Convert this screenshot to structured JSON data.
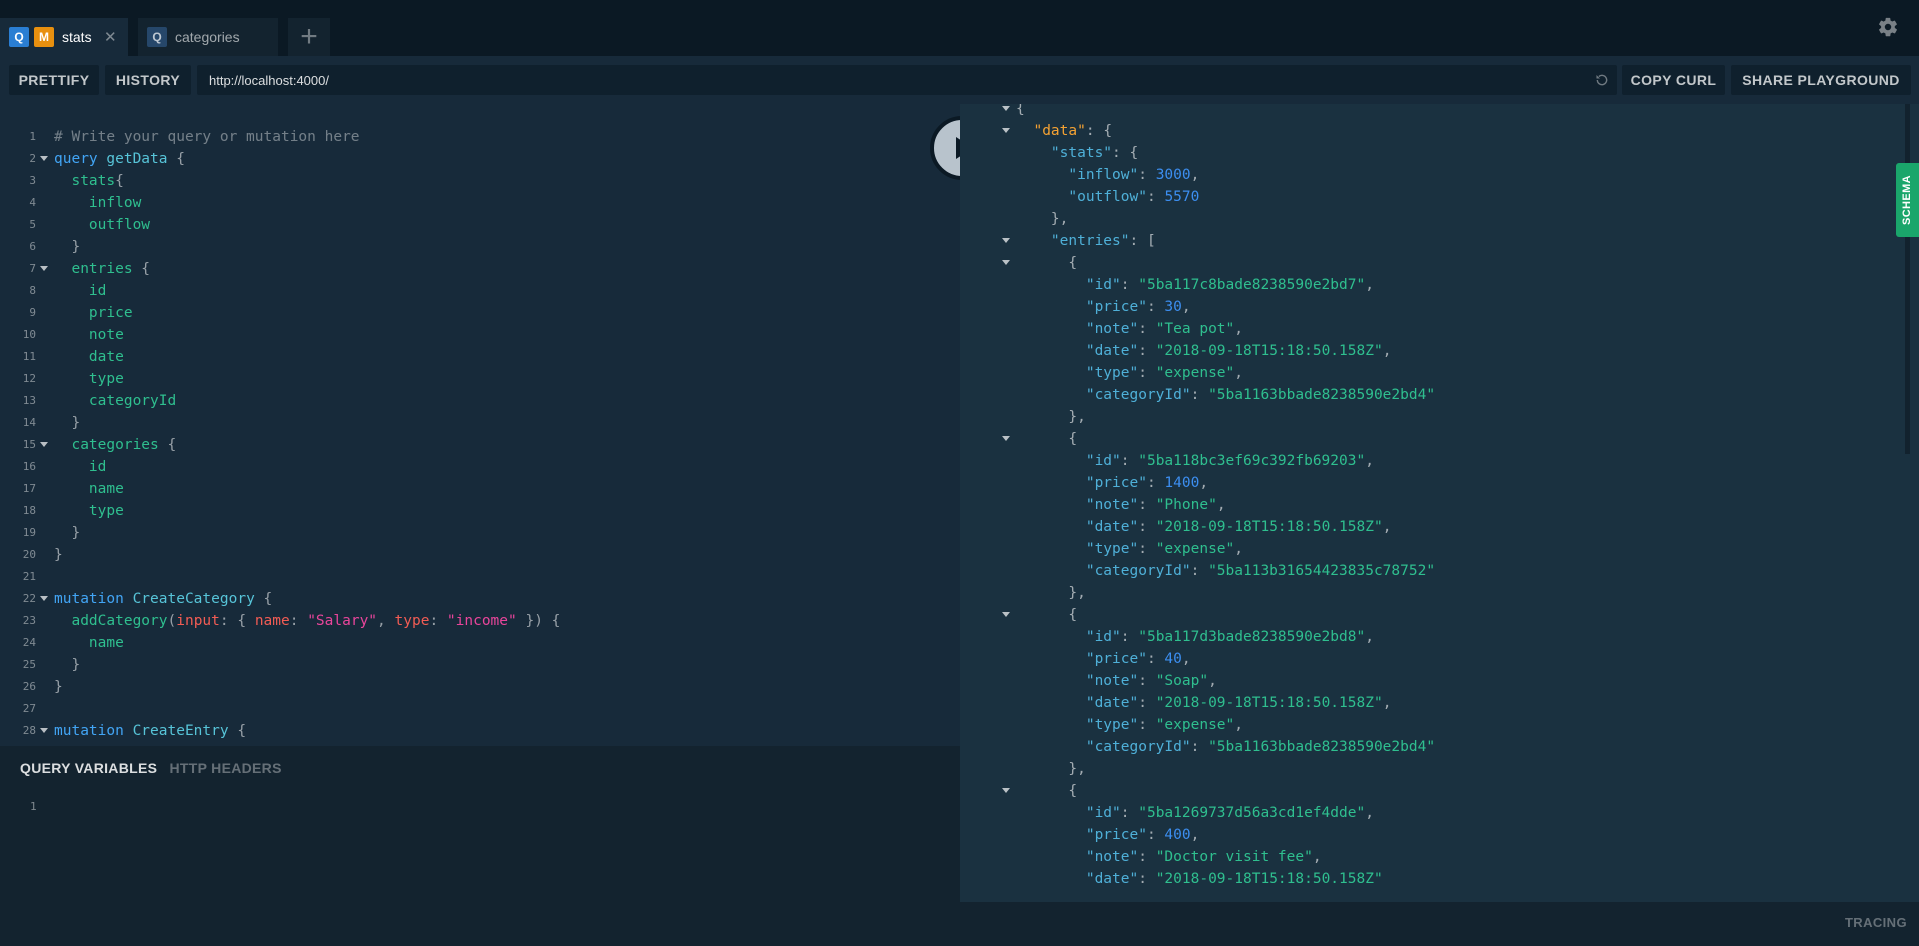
{
  "tabs": [
    {
      "badges": [
        "Q",
        "M"
      ],
      "title": "stats",
      "close": "✕"
    },
    {
      "badges": [
        "Q"
      ],
      "title": "categories"
    }
  ],
  "add_tab_label": "+",
  "toolbar": {
    "prettify": "PRETTIFY",
    "history": "HISTORY",
    "url": "http://localhost:4000/",
    "copy_curl": "COPY CURL",
    "share": "SHARE PLAYGROUND"
  },
  "editor_lines": [
    {
      "n": "1",
      "fold": false,
      "tokens": [
        [
          "c-comment",
          "# Write your query or mutation here"
        ]
      ]
    },
    {
      "n": "2",
      "fold": true,
      "tokens": [
        [
          "c-kw",
          "query "
        ],
        [
          "c-def",
          "getData"
        ],
        [
          "c-punc",
          " {"
        ]
      ]
    },
    {
      "n": "3",
      "fold": false,
      "tokens": [
        [
          "c-field",
          "  stats"
        ],
        [
          "c-punc",
          "{"
        ]
      ]
    },
    {
      "n": "4",
      "fold": false,
      "tokens": [
        [
          "c-field",
          "    inflow"
        ]
      ]
    },
    {
      "n": "5",
      "fold": false,
      "tokens": [
        [
          "c-field",
          "    outflow"
        ]
      ]
    },
    {
      "n": "6",
      "fold": false,
      "tokens": [
        [
          "c-punc",
          "  }"
        ]
      ]
    },
    {
      "n": "7",
      "fold": true,
      "tokens": [
        [
          "c-field",
          "  entries"
        ],
        [
          "c-punc",
          " {"
        ]
      ]
    },
    {
      "n": "8",
      "fold": false,
      "tokens": [
        [
          "c-field",
          "    id"
        ]
      ]
    },
    {
      "n": "9",
      "fold": false,
      "tokens": [
        [
          "c-field",
          "    price"
        ]
      ]
    },
    {
      "n": "10",
      "fold": false,
      "tokens": [
        [
          "c-field",
          "    note"
        ]
      ]
    },
    {
      "n": "11",
      "fold": false,
      "tokens": [
        [
          "c-field",
          "    date"
        ]
      ]
    },
    {
      "n": "12",
      "fold": false,
      "tokens": [
        [
          "c-field",
          "    type"
        ]
      ]
    },
    {
      "n": "13",
      "fold": false,
      "tokens": [
        [
          "c-field",
          "    categoryId"
        ]
      ]
    },
    {
      "n": "14",
      "fold": false,
      "tokens": [
        [
          "c-punc",
          "  }"
        ]
      ]
    },
    {
      "n": "15",
      "fold": true,
      "tokens": [
        [
          "c-field",
          "  categories"
        ],
        [
          "c-punc",
          " {"
        ]
      ]
    },
    {
      "n": "16",
      "fold": false,
      "tokens": [
        [
          "c-field",
          "    id"
        ]
      ]
    },
    {
      "n": "17",
      "fold": false,
      "tokens": [
        [
          "c-field",
          "    name"
        ]
      ]
    },
    {
      "n": "18",
      "fold": false,
      "tokens": [
        [
          "c-field",
          "    type"
        ]
      ]
    },
    {
      "n": "19",
      "fold": false,
      "tokens": [
        [
          "c-punc",
          "  }"
        ]
      ]
    },
    {
      "n": "20",
      "fold": false,
      "tokens": [
        [
          "c-punc",
          "}"
        ]
      ]
    },
    {
      "n": "21",
      "fold": false,
      "tokens": []
    },
    {
      "n": "22",
      "fold": true,
      "tokens": [
        [
          "c-kw",
          "mutation "
        ],
        [
          "c-def",
          "CreateCategory"
        ],
        [
          "c-punc",
          " {"
        ]
      ]
    },
    {
      "n": "23",
      "fold": false,
      "tokens": [
        [
          "c-field",
          "  addCategory"
        ],
        [
          "c-punc",
          "("
        ],
        [
          "c-arg",
          "input"
        ],
        [
          "c-punc",
          ": { "
        ],
        [
          "c-arg",
          "name"
        ],
        [
          "c-punc",
          ": "
        ],
        [
          "c-str",
          "\"Salary\""
        ],
        [
          "c-punc",
          ", "
        ],
        [
          "c-arg",
          "type"
        ],
        [
          "c-punc",
          ": "
        ],
        [
          "c-str",
          "\"income\""
        ],
        [
          "c-punc",
          " }) {"
        ]
      ]
    },
    {
      "n": "24",
      "fold": false,
      "tokens": [
        [
          "c-field",
          "    name"
        ]
      ]
    },
    {
      "n": "25",
      "fold": false,
      "tokens": [
        [
          "c-punc",
          "  }"
        ]
      ]
    },
    {
      "n": "26",
      "fold": false,
      "tokens": [
        [
          "c-punc",
          "}"
        ]
      ]
    },
    {
      "n": "27",
      "fold": false,
      "tokens": []
    },
    {
      "n": "28",
      "fold": true,
      "tokens": [
        [
          "c-kw",
          "mutation "
        ],
        [
          "c-def",
          "CreateEntry"
        ],
        [
          "c-punc",
          " {"
        ]
      ]
    }
  ],
  "vars_panel": {
    "query_variables": "QUERY VARIABLES",
    "http_headers": "HTTP HEADERS",
    "line_number": "1"
  },
  "result_lines": [
    {
      "fold": true,
      "tokens": [
        [
          "r-punc",
          "{"
        ]
      ]
    },
    {
      "fold": true,
      "tokens": [
        [
          "r-punc",
          "  "
        ],
        [
          "r-key-data",
          "\"data\""
        ],
        [
          "r-punc",
          ": {"
        ]
      ]
    },
    {
      "fold": false,
      "tokens": [
        [
          "r-punc",
          "    "
        ],
        [
          "r-key",
          "\"stats\""
        ],
        [
          "r-punc",
          ": {"
        ]
      ]
    },
    {
      "fold": false,
      "tokens": [
        [
          "r-punc",
          "      "
        ],
        [
          "r-key",
          "\"inflow\""
        ],
        [
          "r-punc",
          ": "
        ],
        [
          "r-num",
          "3000"
        ],
        [
          "r-punc",
          ","
        ]
      ]
    },
    {
      "fold": false,
      "tokens": [
        [
          "r-punc",
          "      "
        ],
        [
          "r-key",
          "\"outflow\""
        ],
        [
          "r-punc",
          ": "
        ],
        [
          "r-num",
          "5570"
        ]
      ]
    },
    {
      "fold": false,
      "tokens": [
        [
          "r-punc",
          "    },"
        ]
      ]
    },
    {
      "fold": true,
      "tokens": [
        [
          "r-punc",
          "    "
        ],
        [
          "r-key",
          "\"entries\""
        ],
        [
          "r-punc",
          ": ["
        ]
      ]
    },
    {
      "fold": true,
      "tokens": [
        [
          "r-punc",
          "      {"
        ]
      ]
    },
    {
      "fold": false,
      "tokens": [
        [
          "r-punc",
          "        "
        ],
        [
          "r-key",
          "\"id\""
        ],
        [
          "r-punc",
          ": "
        ],
        [
          "r-str",
          "\"5ba117c8bade8238590e2bd7\""
        ],
        [
          "r-punc",
          ","
        ]
      ]
    },
    {
      "fold": false,
      "tokens": [
        [
          "r-punc",
          "        "
        ],
        [
          "r-key",
          "\"price\""
        ],
        [
          "r-punc",
          ": "
        ],
        [
          "r-num",
          "30"
        ],
        [
          "r-punc",
          ","
        ]
      ]
    },
    {
      "fold": false,
      "tokens": [
        [
          "r-punc",
          "        "
        ],
        [
          "r-key",
          "\"note\""
        ],
        [
          "r-punc",
          ": "
        ],
        [
          "r-str",
          "\"Tea pot\""
        ],
        [
          "r-punc",
          ","
        ]
      ]
    },
    {
      "fold": false,
      "tokens": [
        [
          "r-punc",
          "        "
        ],
        [
          "r-key",
          "\"date\""
        ],
        [
          "r-punc",
          ": "
        ],
        [
          "r-str",
          "\"2018-09-18T15:18:50.158Z\""
        ],
        [
          "r-punc",
          ","
        ]
      ]
    },
    {
      "fold": false,
      "tokens": [
        [
          "r-punc",
          "        "
        ],
        [
          "r-key",
          "\"type\""
        ],
        [
          "r-punc",
          ": "
        ],
        [
          "r-str",
          "\"expense\""
        ],
        [
          "r-punc",
          ","
        ]
      ]
    },
    {
      "fold": false,
      "tokens": [
        [
          "r-punc",
          "        "
        ],
        [
          "r-key",
          "\"categoryId\""
        ],
        [
          "r-punc",
          ": "
        ],
        [
          "r-str",
          "\"5ba1163bbade8238590e2bd4\""
        ]
      ]
    },
    {
      "fold": false,
      "tokens": [
        [
          "r-punc",
          "      },"
        ]
      ]
    },
    {
      "fold": true,
      "tokens": [
        [
          "r-punc",
          "      {"
        ]
      ]
    },
    {
      "fold": false,
      "tokens": [
        [
          "r-punc",
          "        "
        ],
        [
          "r-key",
          "\"id\""
        ],
        [
          "r-punc",
          ": "
        ],
        [
          "r-str",
          "\"5ba118bc3ef69c392fb69203\""
        ],
        [
          "r-punc",
          ","
        ]
      ]
    },
    {
      "fold": false,
      "tokens": [
        [
          "r-punc",
          "        "
        ],
        [
          "r-key",
          "\"price\""
        ],
        [
          "r-punc",
          ": "
        ],
        [
          "r-num",
          "1400"
        ],
        [
          "r-punc",
          ","
        ]
      ]
    },
    {
      "fold": false,
      "tokens": [
        [
          "r-punc",
          "        "
        ],
        [
          "r-key",
          "\"note\""
        ],
        [
          "r-punc",
          ": "
        ],
        [
          "r-str",
          "\"Phone\""
        ],
        [
          "r-punc",
          ","
        ]
      ]
    },
    {
      "fold": false,
      "tokens": [
        [
          "r-punc",
          "        "
        ],
        [
          "r-key",
          "\"date\""
        ],
        [
          "r-punc",
          ": "
        ],
        [
          "r-str",
          "\"2018-09-18T15:18:50.158Z\""
        ],
        [
          "r-punc",
          ","
        ]
      ]
    },
    {
      "fold": false,
      "tokens": [
        [
          "r-punc",
          "        "
        ],
        [
          "r-key",
          "\"type\""
        ],
        [
          "r-punc",
          ": "
        ],
        [
          "r-str",
          "\"expense\""
        ],
        [
          "r-punc",
          ","
        ]
      ]
    },
    {
      "fold": false,
      "tokens": [
        [
          "r-punc",
          "        "
        ],
        [
          "r-key",
          "\"categoryId\""
        ],
        [
          "r-punc",
          ": "
        ],
        [
          "r-str",
          "\"5ba113b31654423835c78752\""
        ]
      ]
    },
    {
      "fold": false,
      "tokens": [
        [
          "r-punc",
          "      },"
        ]
      ]
    },
    {
      "fold": true,
      "tokens": [
        [
          "r-punc",
          "      {"
        ]
      ]
    },
    {
      "fold": false,
      "tokens": [
        [
          "r-punc",
          "        "
        ],
        [
          "r-key",
          "\"id\""
        ],
        [
          "r-punc",
          ": "
        ],
        [
          "r-str",
          "\"5ba117d3bade8238590e2bd8\""
        ],
        [
          "r-punc",
          ","
        ]
      ]
    },
    {
      "fold": false,
      "tokens": [
        [
          "r-punc",
          "        "
        ],
        [
          "r-key",
          "\"price\""
        ],
        [
          "r-punc",
          ": "
        ],
        [
          "r-num",
          "40"
        ],
        [
          "r-punc",
          ","
        ]
      ]
    },
    {
      "fold": false,
      "tokens": [
        [
          "r-punc",
          "        "
        ],
        [
          "r-key",
          "\"note\""
        ],
        [
          "r-punc",
          ": "
        ],
        [
          "r-str",
          "\"Soap\""
        ],
        [
          "r-punc",
          ","
        ]
      ]
    },
    {
      "fold": false,
      "tokens": [
        [
          "r-punc",
          "        "
        ],
        [
          "r-key",
          "\"date\""
        ],
        [
          "r-punc",
          ": "
        ],
        [
          "r-str",
          "\"2018-09-18T15:18:50.158Z\""
        ],
        [
          "r-punc",
          ","
        ]
      ]
    },
    {
      "fold": false,
      "tokens": [
        [
          "r-punc",
          "        "
        ],
        [
          "r-key",
          "\"type\""
        ],
        [
          "r-punc",
          ": "
        ],
        [
          "r-str",
          "\"expense\""
        ],
        [
          "r-punc",
          ","
        ]
      ]
    },
    {
      "fold": false,
      "tokens": [
        [
          "r-punc",
          "        "
        ],
        [
          "r-key",
          "\"categoryId\""
        ],
        [
          "r-punc",
          ": "
        ],
        [
          "r-str",
          "\"5ba1163bbade8238590e2bd4\""
        ]
      ]
    },
    {
      "fold": false,
      "tokens": [
        [
          "r-punc",
          "      },"
        ]
      ]
    },
    {
      "fold": true,
      "tokens": [
        [
          "r-punc",
          "      {"
        ]
      ]
    },
    {
      "fold": false,
      "tokens": [
        [
          "r-punc",
          "        "
        ],
        [
          "r-key",
          "\"id\""
        ],
        [
          "r-punc",
          ": "
        ],
        [
          "r-str",
          "\"5ba1269737d56a3cd1ef4dde\""
        ],
        [
          "r-punc",
          ","
        ]
      ]
    },
    {
      "fold": false,
      "tokens": [
        [
          "r-punc",
          "        "
        ],
        [
          "r-key",
          "\"price\""
        ],
        [
          "r-punc",
          ": "
        ],
        [
          "r-num",
          "400"
        ],
        [
          "r-punc",
          ","
        ]
      ]
    },
    {
      "fold": false,
      "tokens": [
        [
          "r-punc",
          "        "
        ],
        [
          "r-key",
          "\"note\""
        ],
        [
          "r-punc",
          ": "
        ],
        [
          "r-str",
          "\"Doctor visit fee\""
        ],
        [
          "r-punc",
          ","
        ]
      ]
    },
    {
      "fold": false,
      "tokens": [
        [
          "r-punc",
          "        "
        ],
        [
          "r-key",
          "\"date\""
        ],
        [
          "r-punc",
          ": "
        ],
        [
          "r-str",
          "\"2018-09-18T15:18:50.158Z\""
        ]
      ]
    }
  ],
  "schema_label": "SCHEMA",
  "tracing_label": "TRACING",
  "colors": {
    "background": "#172a3a",
    "tabbar": "#0b1924",
    "query_badge": "#2a7ed3",
    "mutation_badge": "#e8900f",
    "schema_tab": "#1aa66b"
  },
  "icons": {
    "settings": "gear-icon",
    "run": "play-icon",
    "reload": "reload-icon"
  }
}
